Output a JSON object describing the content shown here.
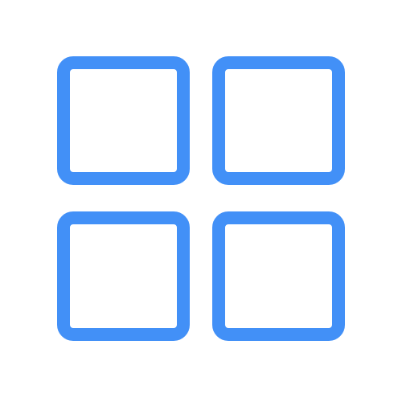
{
  "icon": {
    "name": "grid-icon",
    "color": "#4290F7",
    "tiles": [
      "top-left",
      "top-right",
      "bottom-left",
      "bottom-right"
    ]
  }
}
